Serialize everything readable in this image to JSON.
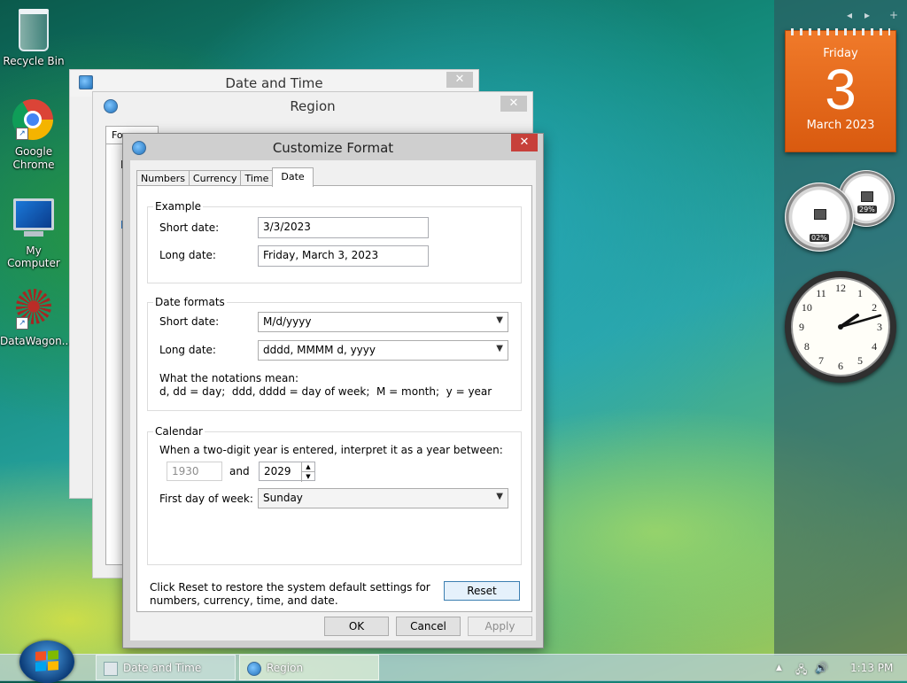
{
  "desktop": {
    "icons": [
      {
        "label": "Recycle Bin"
      },
      {
        "label": "Google Chrome"
      },
      {
        "label": "My Computer"
      },
      {
        "label": "DataWagon..."
      }
    ]
  },
  "sidebar": {
    "controls": {
      "prev": "◂",
      "next": "▸",
      "add": "+"
    },
    "calendar": {
      "weekday": "Friday",
      "day": "3",
      "month_year": "March 2023"
    },
    "cpu_meter": {
      "cpu": "02%",
      "memory": "29%"
    },
    "clock": {
      "numerals": [
        "12",
        "1",
        "2",
        "3",
        "4",
        "5",
        "6",
        "7",
        "8",
        "9",
        "10",
        "11"
      ]
    }
  },
  "windows": {
    "date_time": {
      "title": "Date and Time",
      "close": "✕"
    },
    "region": {
      "title": "Region",
      "close": "✕",
      "tab_partial": "Fo",
      "label_partial": "F",
      "link_partial": "L"
    },
    "customize_format": {
      "title": "Customize Format",
      "close": "✕",
      "tabs": [
        {
          "label": "Numbers"
        },
        {
          "label": "Currency"
        },
        {
          "label": "Time"
        },
        {
          "label": "Date",
          "active": true
        }
      ],
      "example": {
        "legend": "Example",
        "short_label": "Short date:",
        "short_value": "3/3/2023",
        "long_label": "Long date:",
        "long_value": "Friday, March 3, 2023"
      },
      "formats": {
        "legend": "Date formats",
        "short_label": "Short date:",
        "short_value": "M/d/yyyy",
        "long_label": "Long date:",
        "long_value": "dddd, MMMM d, yyyy",
        "notation_title": "What the notations mean:",
        "notation_text": "d, dd = day;  ddd, dddd = day of week;  M = month;  y = year"
      },
      "calendar": {
        "legend": "Calendar",
        "two_digit_text": "When a two-digit year is entered, interpret it as a year between:",
        "year_from": "1930",
        "and_label": "and",
        "year_to": "2029",
        "first_day_label": "First day of week:",
        "first_day_value": "Sunday"
      },
      "reset_text_line1": "Click Reset to restore the system default settings for",
      "reset_text_line2": "numbers, currency, time, and date.",
      "reset_button": "Reset",
      "ok_button": "OK",
      "cancel_button": "Cancel",
      "apply_button": "Apply"
    }
  },
  "taskbar": {
    "items": [
      {
        "label": "Date and Time"
      },
      {
        "label": "Region"
      }
    ],
    "tray": {
      "show_hidden": "▲",
      "network": "🖧",
      "volume": "🔊",
      "time": "1:13 PM"
    }
  },
  "colors": {
    "calendar_orange": "#e8661a",
    "close_red": "#c7403a",
    "accent_blue": "#3c7fb1"
  }
}
